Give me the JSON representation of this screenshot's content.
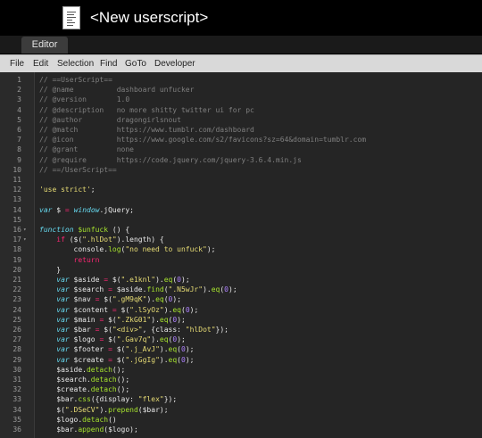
{
  "window": {
    "title": "<New userscript>"
  },
  "tabs": [
    {
      "label": "Editor"
    }
  ],
  "menu": [
    {
      "label": "File"
    },
    {
      "label": "Edit"
    },
    {
      "label": "Selection"
    },
    {
      "label": "Find"
    },
    {
      "label": "GoTo"
    },
    {
      "label": "Developer"
    }
  ],
  "editor": {
    "lines": [
      {
        "n": "1",
        "fold": "",
        "tokens": [
          {
            "t": "// ==UserScript==",
            "c": "c"
          }
        ]
      },
      {
        "n": "2",
        "fold": "",
        "tokens": [
          {
            "t": "// @name          dashboard unfucker",
            "c": "c"
          }
        ]
      },
      {
        "n": "3",
        "fold": "",
        "tokens": [
          {
            "t": "// @version       1.0",
            "c": "c"
          }
        ]
      },
      {
        "n": "4",
        "fold": "",
        "tokens": [
          {
            "t": "// @description   no more shitty twitter ui for pc",
            "c": "c"
          }
        ]
      },
      {
        "n": "5",
        "fold": "",
        "tokens": [
          {
            "t": "// @author        dragongirlsnout",
            "c": "c"
          }
        ]
      },
      {
        "n": "6",
        "fold": "",
        "tokens": [
          {
            "t": "// @match         https://www.tumblr.com/dashboard",
            "c": "c"
          }
        ]
      },
      {
        "n": "7",
        "fold": "",
        "tokens": [
          {
            "t": "// @icon          https://www.google.com/s2/favicons?sz=64&domain=tumblr.com",
            "c": "c"
          }
        ]
      },
      {
        "n": "8",
        "fold": "",
        "tokens": [
          {
            "t": "// @grant         none",
            "c": "c"
          }
        ]
      },
      {
        "n": "9",
        "fold": "",
        "tokens": [
          {
            "t": "// @require       https://code.jquery.com/jquery-3.6.4.min.js",
            "c": "c"
          }
        ]
      },
      {
        "n": "10",
        "fold": "",
        "tokens": [
          {
            "t": "// ==/UserScript==",
            "c": "c"
          }
        ]
      },
      {
        "n": "11",
        "fold": "",
        "tokens": []
      },
      {
        "n": "12",
        "fold": "",
        "tokens": [
          {
            "t": "'use strict'",
            "c": "s"
          },
          {
            "t": ";",
            "c": "w"
          }
        ]
      },
      {
        "n": "13",
        "fold": "",
        "tokens": []
      },
      {
        "n": "14",
        "fold": "",
        "tokens": [
          {
            "t": "var",
            "c": "ki"
          },
          {
            "t": " $ ",
            "c": "w"
          },
          {
            "t": "=",
            "c": "k"
          },
          {
            "t": " ",
            "c": "w"
          },
          {
            "t": "window",
            "c": "ki"
          },
          {
            "t": ".jQuery;",
            "c": "w"
          }
        ]
      },
      {
        "n": "15",
        "fold": "",
        "tokens": []
      },
      {
        "n": "16",
        "fold": "▾",
        "tokens": [
          {
            "t": "function",
            "c": "ki"
          },
          {
            "t": " ",
            "c": "w"
          },
          {
            "t": "$unfuck",
            "c": "f"
          },
          {
            "t": " () {",
            "c": "w"
          }
        ]
      },
      {
        "n": "17",
        "fold": "▾",
        "tokens": [
          {
            "t": "    ",
            "c": "w"
          },
          {
            "t": "if",
            "c": "k"
          },
          {
            "t": " ($(",
            "c": "w"
          },
          {
            "t": "\".hlDot\"",
            "c": "s"
          },
          {
            "t": ").length) {",
            "c": "w"
          }
        ]
      },
      {
        "n": "18",
        "fold": "",
        "tokens": [
          {
            "t": "        console.",
            "c": "w"
          },
          {
            "t": "log",
            "c": "f"
          },
          {
            "t": "(",
            "c": "w"
          },
          {
            "t": "\"no need to unfuck\"",
            "c": "s"
          },
          {
            "t": ");",
            "c": "w"
          }
        ]
      },
      {
        "n": "19",
        "fold": "",
        "tokens": [
          {
            "t": "        ",
            "c": "w"
          },
          {
            "t": "return",
            "c": "k"
          }
        ]
      },
      {
        "n": "20",
        "fold": "",
        "tokens": [
          {
            "t": "    }",
            "c": "w"
          }
        ]
      },
      {
        "n": "21",
        "fold": "",
        "tokens": [
          {
            "t": "    ",
            "c": "w"
          },
          {
            "t": "var",
            "c": "ki"
          },
          {
            "t": " $aside ",
            "c": "w"
          },
          {
            "t": "=",
            "c": "k"
          },
          {
            "t": " $(",
            "c": "w"
          },
          {
            "t": "\".e1knl\"",
            "c": "s"
          },
          {
            "t": ").",
            "c": "w"
          },
          {
            "t": "eq",
            "c": "f"
          },
          {
            "t": "(",
            "c": "w"
          },
          {
            "t": "0",
            "c": "n"
          },
          {
            "t": ");",
            "c": "w"
          }
        ]
      },
      {
        "n": "22",
        "fold": "",
        "tokens": [
          {
            "t": "    ",
            "c": "w"
          },
          {
            "t": "var",
            "c": "ki"
          },
          {
            "t": " $search ",
            "c": "w"
          },
          {
            "t": "=",
            "c": "k"
          },
          {
            "t": " $aside.",
            "c": "w"
          },
          {
            "t": "find",
            "c": "f"
          },
          {
            "t": "(",
            "c": "w"
          },
          {
            "t": "\".N5wJr\"",
            "c": "s"
          },
          {
            "t": ").",
            "c": "w"
          },
          {
            "t": "eq",
            "c": "f"
          },
          {
            "t": "(",
            "c": "w"
          },
          {
            "t": "0",
            "c": "n"
          },
          {
            "t": ");",
            "c": "w"
          }
        ]
      },
      {
        "n": "23",
        "fold": "",
        "tokens": [
          {
            "t": "    ",
            "c": "w"
          },
          {
            "t": "var",
            "c": "ki"
          },
          {
            "t": " $nav ",
            "c": "w"
          },
          {
            "t": "=",
            "c": "k"
          },
          {
            "t": " $(",
            "c": "w"
          },
          {
            "t": "\".gM9qK\"",
            "c": "s"
          },
          {
            "t": ").",
            "c": "w"
          },
          {
            "t": "eq",
            "c": "f"
          },
          {
            "t": "(",
            "c": "w"
          },
          {
            "t": "0",
            "c": "n"
          },
          {
            "t": ");",
            "c": "w"
          }
        ]
      },
      {
        "n": "24",
        "fold": "",
        "tokens": [
          {
            "t": "    ",
            "c": "w"
          },
          {
            "t": "var",
            "c": "ki"
          },
          {
            "t": " $content ",
            "c": "w"
          },
          {
            "t": "=",
            "c": "k"
          },
          {
            "t": " $(",
            "c": "w"
          },
          {
            "t": "\".lSyOz\"",
            "c": "s"
          },
          {
            "t": ").",
            "c": "w"
          },
          {
            "t": "eq",
            "c": "f"
          },
          {
            "t": "(",
            "c": "w"
          },
          {
            "t": "0",
            "c": "n"
          },
          {
            "t": ");",
            "c": "w"
          }
        ]
      },
      {
        "n": "25",
        "fold": "",
        "tokens": [
          {
            "t": "    ",
            "c": "w"
          },
          {
            "t": "var",
            "c": "ki"
          },
          {
            "t": " $main ",
            "c": "w"
          },
          {
            "t": "=",
            "c": "k"
          },
          {
            "t": " $(",
            "c": "w"
          },
          {
            "t": "\".ZkG01\"",
            "c": "s"
          },
          {
            "t": ").",
            "c": "w"
          },
          {
            "t": "eq",
            "c": "f"
          },
          {
            "t": "(",
            "c": "w"
          },
          {
            "t": "0",
            "c": "n"
          },
          {
            "t": ");",
            "c": "w"
          }
        ]
      },
      {
        "n": "26",
        "fold": "",
        "tokens": [
          {
            "t": "    ",
            "c": "w"
          },
          {
            "t": "var",
            "c": "ki"
          },
          {
            "t": " $bar ",
            "c": "w"
          },
          {
            "t": "=",
            "c": "k"
          },
          {
            "t": " $(",
            "c": "w"
          },
          {
            "t": "\"<div>\"",
            "c": "s"
          },
          {
            "t": ", {class: ",
            "c": "w"
          },
          {
            "t": "\"hlDot\"",
            "c": "s"
          },
          {
            "t": "});",
            "c": "w"
          }
        ]
      },
      {
        "n": "27",
        "fold": "",
        "tokens": [
          {
            "t": "    ",
            "c": "w"
          },
          {
            "t": "var",
            "c": "ki"
          },
          {
            "t": " $logo ",
            "c": "w"
          },
          {
            "t": "=",
            "c": "k"
          },
          {
            "t": " $(",
            "c": "w"
          },
          {
            "t": "\".Gav7q\"",
            "c": "s"
          },
          {
            "t": ").",
            "c": "w"
          },
          {
            "t": "eq",
            "c": "f"
          },
          {
            "t": "(",
            "c": "w"
          },
          {
            "t": "0",
            "c": "n"
          },
          {
            "t": ");",
            "c": "w"
          }
        ]
      },
      {
        "n": "28",
        "fold": "",
        "tokens": [
          {
            "t": "    ",
            "c": "w"
          },
          {
            "t": "var",
            "c": "ki"
          },
          {
            "t": " $footer ",
            "c": "w"
          },
          {
            "t": "=",
            "c": "k"
          },
          {
            "t": " $(",
            "c": "w"
          },
          {
            "t": "\".j_AvJ\"",
            "c": "s"
          },
          {
            "t": ").",
            "c": "w"
          },
          {
            "t": "eq",
            "c": "f"
          },
          {
            "t": "(",
            "c": "w"
          },
          {
            "t": "0",
            "c": "n"
          },
          {
            "t": ");",
            "c": "w"
          }
        ]
      },
      {
        "n": "29",
        "fold": "",
        "tokens": [
          {
            "t": "    ",
            "c": "w"
          },
          {
            "t": "var",
            "c": "ki"
          },
          {
            "t": " $create ",
            "c": "w"
          },
          {
            "t": "=",
            "c": "k"
          },
          {
            "t": " $(",
            "c": "w"
          },
          {
            "t": "\".jGgIg\"",
            "c": "s"
          },
          {
            "t": ").",
            "c": "w"
          },
          {
            "t": "eq",
            "c": "f"
          },
          {
            "t": "(",
            "c": "w"
          },
          {
            "t": "0",
            "c": "n"
          },
          {
            "t": ");",
            "c": "w"
          }
        ]
      },
      {
        "n": "30",
        "fold": "",
        "tokens": [
          {
            "t": "    $aside.",
            "c": "w"
          },
          {
            "t": "detach",
            "c": "f"
          },
          {
            "t": "();",
            "c": "w"
          }
        ]
      },
      {
        "n": "31",
        "fold": "",
        "tokens": [
          {
            "t": "    $search.",
            "c": "w"
          },
          {
            "t": "detach",
            "c": "f"
          },
          {
            "t": "();",
            "c": "w"
          }
        ]
      },
      {
        "n": "32",
        "fold": "",
        "tokens": [
          {
            "t": "    $create.",
            "c": "w"
          },
          {
            "t": "detach",
            "c": "f"
          },
          {
            "t": "();",
            "c": "w"
          }
        ]
      },
      {
        "n": "33",
        "fold": "",
        "tokens": [
          {
            "t": "    $bar.",
            "c": "w"
          },
          {
            "t": "css",
            "c": "f"
          },
          {
            "t": "({display: ",
            "c": "w"
          },
          {
            "t": "\"flex\"",
            "c": "s"
          },
          {
            "t": "});",
            "c": "w"
          }
        ]
      },
      {
        "n": "34",
        "fold": "",
        "tokens": [
          {
            "t": "    $(",
            "c": "w"
          },
          {
            "t": "\".DSeCV\"",
            "c": "s"
          },
          {
            "t": ").",
            "c": "w"
          },
          {
            "t": "prepend",
            "c": "f"
          },
          {
            "t": "($bar);",
            "c": "w"
          }
        ]
      },
      {
        "n": "35",
        "fold": "",
        "tokens": [
          {
            "t": "    $logo.",
            "c": "w"
          },
          {
            "t": "detach",
            "c": "f"
          },
          {
            "t": "()",
            "c": "w"
          }
        ]
      },
      {
        "n": "36",
        "fold": "",
        "tokens": [
          {
            "t": "    $bar.",
            "c": "w"
          },
          {
            "t": "append",
            "c": "f"
          },
          {
            "t": "($logo);",
            "c": "w"
          }
        ]
      }
    ]
  }
}
